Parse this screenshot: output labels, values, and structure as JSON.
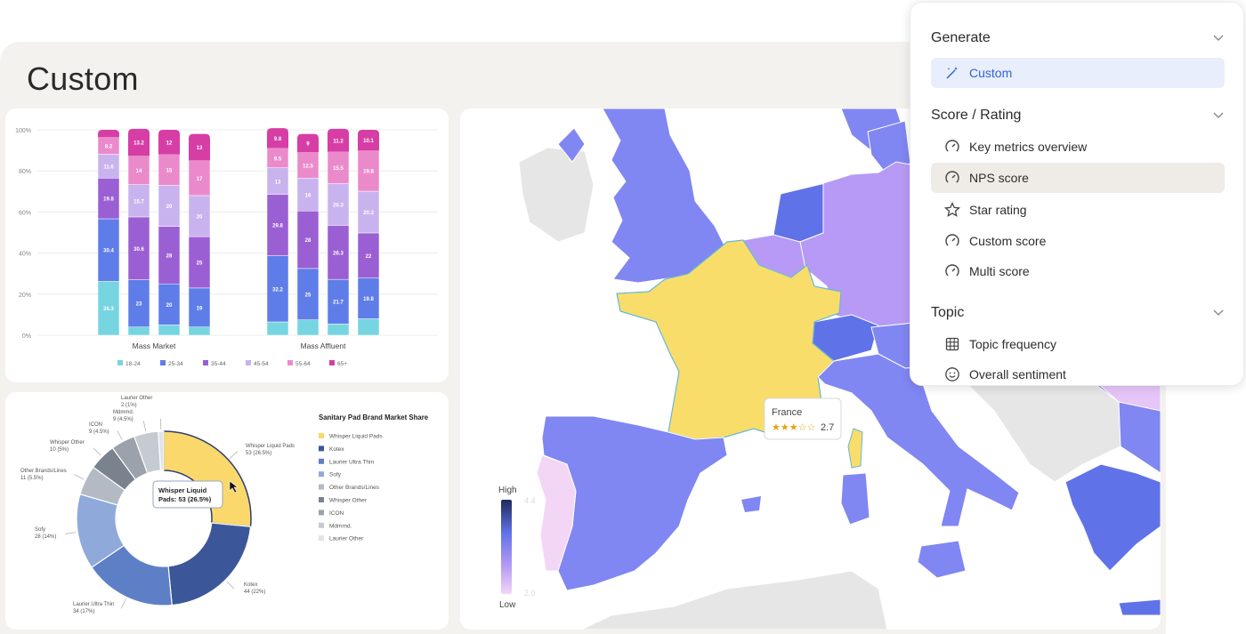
{
  "page": {
    "title": "Custom"
  },
  "panel": {
    "sections": [
      {
        "title": "Generate",
        "items": [
          {
            "label": "Custom",
            "icon": "magic-wand-icon",
            "state": "active"
          }
        ]
      },
      {
        "title": "Score / Rating",
        "items": [
          {
            "label": "Key metrics overview",
            "icon": "gauge-icon"
          },
          {
            "label": "NPS score",
            "icon": "gauge-icon",
            "state": "hover"
          },
          {
            "label": "Star rating",
            "icon": "star-icon"
          },
          {
            "label": "Custom score",
            "icon": "gauge-icon"
          },
          {
            "label": "Multi score",
            "icon": "gauge-icon"
          }
        ]
      },
      {
        "title": "Topic",
        "items": [
          {
            "label": "Topic frequency",
            "icon": "grid-icon"
          },
          {
            "label": "Overall sentiment",
            "icon": "smiley-icon"
          }
        ]
      }
    ]
  },
  "chart_data": [
    {
      "type": "bar",
      "stacked": true,
      "y_tick_labels": [
        "0%",
        "20%",
        "40%",
        "60%",
        "80%",
        "100%"
      ],
      "ylim": [
        0,
        100
      ],
      "groups": [
        "Mass Market",
        "Mass Affluent"
      ],
      "bars_per_group": 4,
      "series": [
        {
          "name": "18-24",
          "color": "#76d5e0",
          "values": [
            26.3,
            4,
            5,
            4,
            6.5,
            7.5,
            5.5,
            8
          ]
        },
        {
          "name": "25-34",
          "color": "#5f7de8",
          "values": [
            30.4,
            23,
            20,
            19,
            32.2,
            25,
            21.7,
            19.8
          ]
        },
        {
          "name": "35-44",
          "color": "#9b5fd4",
          "values": [
            19.8,
            30.6,
            28,
            25,
            29.8,
            28,
            26.3,
            22
          ]
        },
        {
          "name": "45-54",
          "color": "#c9b3ee",
          "values": [
            11.6,
            15.7,
            20,
            20,
            13,
            16,
            20.3,
            20.3
          ]
        },
        {
          "name": "55-64",
          "color": "#eb8acb",
          "values": [
            8.2,
            14,
            15,
            17,
            9.5,
            12.5,
            15.5,
            19.8
          ]
        },
        {
          "name": "65+",
          "color": "#d63ea6",
          "values": [
            3.7,
            13.2,
            12,
            13,
            9.8,
            9,
            11.2,
            10.1
          ]
        }
      ],
      "value_labels": [
        [
          "26.3",
          "30.4",
          "19.8",
          "11.6",
          "8.2",
          ""
        ],
        [
          "",
          "23",
          "30.6",
          "15.7",
          "14",
          "13.2"
        ],
        [
          "",
          "20",
          "28",
          "20",
          "15",
          "12"
        ],
        [
          "",
          "19",
          "25",
          "20",
          "17",
          "13"
        ],
        [
          "",
          "32.2",
          "29.8",
          "13",
          "9.5",
          "9.8"
        ],
        [
          "",
          "25",
          "28",
          "16",
          "12.5",
          "9"
        ],
        [
          "",
          "21.7",
          "26.3",
          "20.3",
          "15.5",
          "11.2"
        ],
        [
          "",
          "19.8",
          "22",
          "20.3",
          "19.8",
          "10.1"
        ]
      ]
    },
    {
      "type": "pie",
      "donut": true,
      "title": "Sanitary Pad Brand Market Share",
      "slices": [
        {
          "name": "Whisper Liquid Pads",
          "value": 53,
          "label": "Whisper Liquid Pads\n53 (26.5%)",
          "color": "#fad86b"
        },
        {
          "name": "Kotex",
          "value": 44,
          "label": "Kotex\n44 (22%)",
          "color": "#3c5799"
        },
        {
          "name": "Laurier Ultra Thin",
          "value": 34,
          "label": "Laurier Ultra Thin\n34 (17%)",
          "color": "#5d7fc6"
        },
        {
          "name": "Sofy",
          "value": 28,
          "label": "Sofy\n28 (14%)",
          "color": "#8fa9da"
        },
        {
          "name": "Other Brands/Lines",
          "value": 11,
          "label": "Other Brands/Lines\n11 (5.5%)",
          "color": "#b4bac4"
        },
        {
          "name": "Whisper Other",
          "value": 10,
          "label": "Whisper Other\n10 (5%)",
          "color": "#7a828d"
        },
        {
          "name": "ICON",
          "value": 9,
          "label": "ICON\n9 (4.5%)",
          "color": "#9ba2ac"
        },
        {
          "name": "Mdmmd.",
          "value": 9,
          "label": "Mdmmd.\n9 (4.5%)",
          "color": "#c6cbd2"
        },
        {
          "name": "Laurier Other",
          "value": 2,
          "label": "Laurier Other\n2 (1%)",
          "color": "#e1e3e7"
        }
      ],
      "tooltip": "Whisper Liquid\nPads: 53 (26.5%)"
    }
  ],
  "map": {
    "legend": {
      "high": "High",
      "low": "Low",
      "max_faded": "4.4",
      "min_faded": "2.0"
    },
    "tooltip": {
      "country": "France",
      "stars": 2.7,
      "value": "2.7"
    },
    "colors": {
      "sea": "#ffffff",
      "land_gray": "#e6e6e6",
      "france": "#f9dd6a",
      "blue": "#8086f2",
      "lavender": "#b69af5",
      "pink": "#f3d6f6",
      "deep_blue": "#6072e8"
    }
  }
}
